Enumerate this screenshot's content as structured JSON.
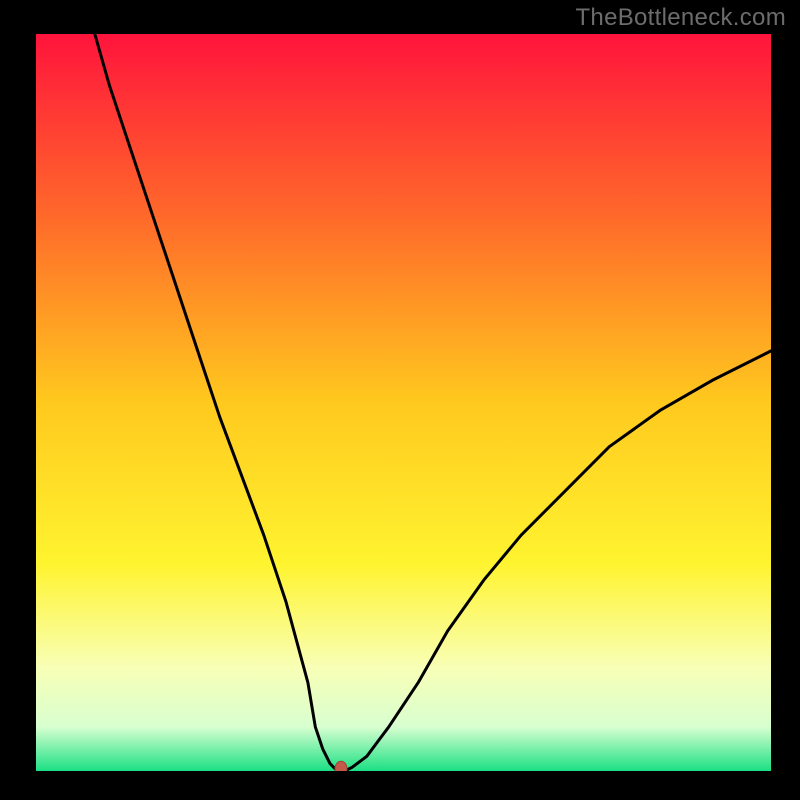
{
  "watermark": "TheBottleneck.com",
  "colors": {
    "background_black": "#000000",
    "gradient_stops": [
      {
        "offset": 0.0,
        "color": "#ff143c"
      },
      {
        "offset": 0.25,
        "color": "#ff6a2a"
      },
      {
        "offset": 0.5,
        "color": "#ffc91e"
      },
      {
        "offset": 0.72,
        "color": "#fff430"
      },
      {
        "offset": 0.86,
        "color": "#f8ffb6"
      },
      {
        "offset": 0.94,
        "color": "#d8ffd0"
      },
      {
        "offset": 1.0,
        "color": "#1be084"
      }
    ],
    "curve_color": "#000000",
    "marker_fill": "#c35a4a",
    "marker_stroke": "#a04338"
  },
  "chart_data": {
    "type": "line",
    "title": "",
    "xlabel": "",
    "ylabel": "",
    "xlim": [
      0,
      100
    ],
    "ylim": [
      0,
      100
    ],
    "series": [
      {
        "name": "bottleneck-curve",
        "x": [
          8,
          10,
          13,
          16,
          19,
          22,
          25,
          28,
          31,
          34,
          37,
          38,
          39,
          40,
          41,
          42,
          43,
          45,
          48,
          52,
          56,
          61,
          66,
          72,
          78,
          85,
          92,
          100
        ],
        "y": [
          100,
          93,
          84,
          75,
          66,
          57,
          48,
          40,
          32,
          23,
          12,
          6,
          3,
          1,
          0,
          0,
          0.5,
          2,
          6,
          12,
          19,
          26,
          32,
          38,
          44,
          49,
          53,
          57
        ]
      }
    ],
    "marker": {
      "x": 41.5,
      "y": 0.3
    }
  }
}
